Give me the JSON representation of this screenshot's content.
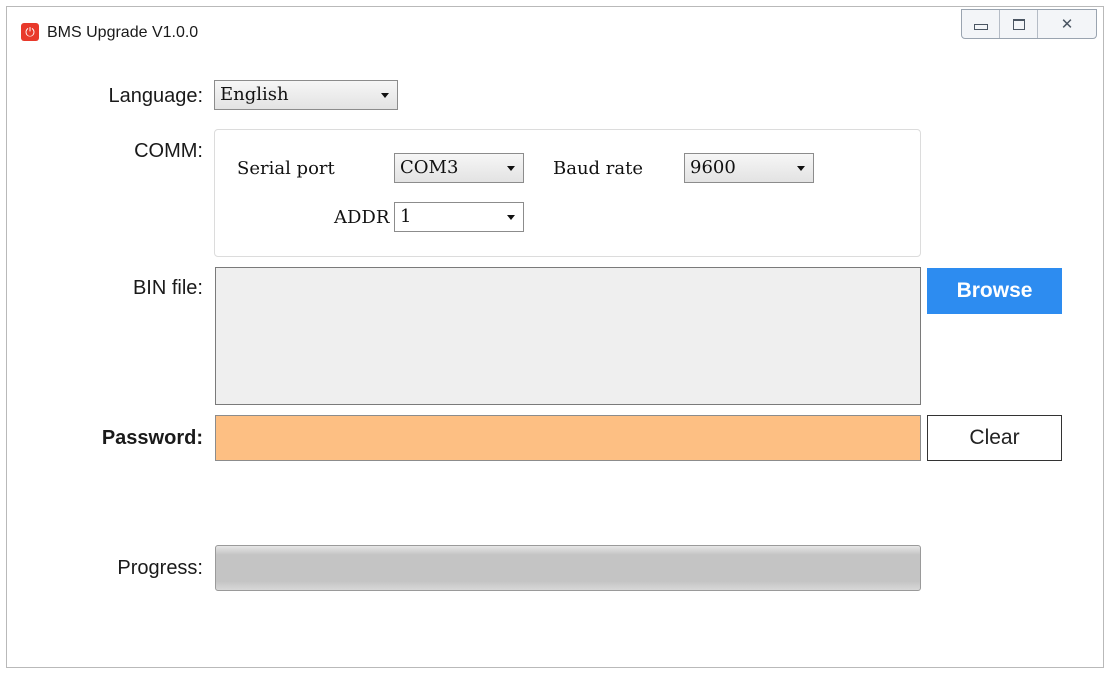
{
  "window": {
    "title": "BMS Upgrade V1.0.0"
  },
  "labels": {
    "language": "Language:",
    "comm": "COMM:",
    "bin_file": "BIN file:",
    "password": "Password:",
    "progress": "Progress:"
  },
  "language_select": {
    "value": "English"
  },
  "comm": {
    "serial_port_label": "Serial port",
    "serial_port_value": "COM3",
    "baud_rate_label": "Baud rate",
    "baud_rate_value": "9600",
    "addr_label": "ADDR",
    "addr_value": "1"
  },
  "buttons": {
    "browse": "Browse",
    "clear": "Clear"
  },
  "bin_file": {
    "value": ""
  },
  "password": {
    "value": ""
  },
  "progress": {
    "value": 0
  },
  "colors": {
    "accent": "#2d8cf0",
    "password_bg": "#fdbf83",
    "bin_box_bg": "#efefef",
    "app_icon": "#e8392b"
  },
  "icons": {
    "app": "app-logo-icon",
    "minimize": "minimize-icon",
    "maximize": "maximize-icon",
    "close": "close-icon",
    "dropdown": "chevron-down-icon"
  }
}
